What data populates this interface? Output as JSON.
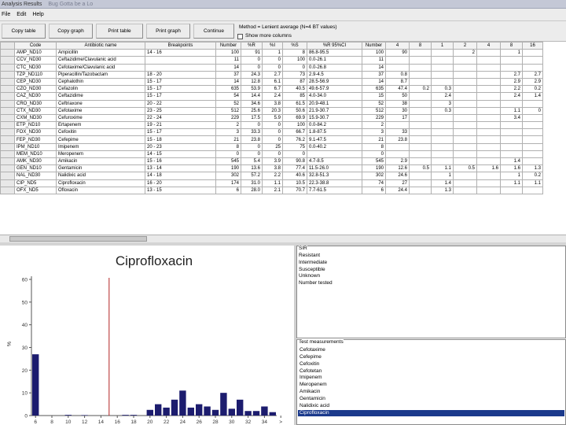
{
  "window": {
    "title": "Analysis Results",
    "subtitle": "Bug Gotta be a Lo"
  },
  "menu": {
    "items": [
      "File",
      "Edit",
      "Help"
    ]
  },
  "toolbar": {
    "copy_table": "Copy table",
    "copy_graph": "Copy graph",
    "print_table": "Print table",
    "print_graph": "Print graph",
    "continue": "Continue",
    "note": "Method = Lenient average (N=4 BT values)",
    "show_more": "Show more columns"
  },
  "table": {
    "columns": [
      "Code",
      "Antibiotic name",
      "Breakpoints",
      "Number",
      "%R",
      "%I",
      "%S",
      "%R 95%CI",
      "Number",
      "4",
      "8",
      "1",
      "2",
      "4",
      "8",
      "16"
    ],
    "rows": [
      [
        "AMP_ND10",
        "Ampicillin",
        "14 - 16",
        "100",
        "91",
        "1",
        "8",
        "86.8-95.5",
        "100",
        "90",
        "",
        "",
        "2",
        "",
        "1",
        ""
      ],
      [
        "CCV_ND30",
        "Ceftazidime/Clavulanic acid",
        "",
        "11",
        "0",
        "0",
        "100",
        "0.0-26.1",
        "11",
        "",
        "",
        "",
        "",
        "",
        "",
        ""
      ],
      [
        "CTC_ND30",
        "Cefotaxime/Clavulanic acid",
        "",
        "14",
        "0",
        "0",
        "0",
        "0.0-26.8",
        "14",
        "",
        "",
        "",
        "",
        "",
        "",
        ""
      ],
      [
        "TZP_ND110",
        "Piperacillin/Tazobactam",
        "18 - 20",
        "37",
        "24.3",
        "2.7",
        "73",
        "2.9-4.5",
        "37",
        "0.8",
        "",
        "",
        "",
        "",
        "2.7",
        "2.7"
      ],
      [
        "CEP_ND30",
        "Cephalothin",
        "15 - 17",
        "14",
        "12.8",
        "6.1",
        "87",
        "28.5-56.9",
        "14",
        "8.7",
        "",
        "",
        "",
        "",
        "2.9",
        "2.9"
      ],
      [
        "CZO_ND30",
        "Cefazolin",
        "15 - 17",
        "635",
        "53.9",
        "6.7",
        "40.5",
        "49.6-57.9",
        "635",
        "47.4",
        "0.2",
        "0.3",
        "",
        "",
        "2.2",
        "0.2"
      ],
      [
        "CAZ_ND30",
        "Ceftazidime",
        "15 - 17",
        "54",
        "14.4",
        "2.4",
        "85",
        "4.0-34.0",
        "15",
        "50",
        "",
        "2.4",
        "",
        "",
        "2.4",
        "1.4"
      ],
      [
        "CRO_ND30",
        "Ceftriaxone",
        "20 - 22",
        "52",
        "34.6",
        "3.8",
        "61.5",
        "20.9-48.1",
        "52",
        "38",
        "",
        "3",
        "",
        "",
        "",
        ""
      ],
      [
        "CTX_ND30",
        "Cefotaxime",
        "23 - 25",
        "512",
        "25.6",
        "20.3",
        "50.6",
        "21.9-30.7",
        "512",
        "30",
        "",
        "0.3",
        "",
        "",
        "1.1",
        "0"
      ],
      [
        "CXM_ND30",
        "Cefuroxime",
        "22 - 24",
        "229",
        "17.5",
        "5.9",
        "69.9",
        "15.9-30.7",
        "229",
        "17",
        "",
        "",
        "",
        "",
        "3.4",
        ""
      ],
      [
        "ETP_ND10",
        "Ertapenem",
        "19 - 21",
        "2",
        "0",
        "0",
        "100",
        "0.0-84.2",
        "2",
        "",
        "",
        "",
        "",
        "",
        "",
        ""
      ],
      [
        "FOX_ND30",
        "Cefoxitin",
        "15 - 17",
        "3",
        "33.3",
        "0",
        "66.7",
        "1.8-87.5",
        "3",
        "33",
        "",
        "",
        "",
        "",
        "",
        ""
      ],
      [
        "FEP_ND30",
        "Cefepime",
        "15 - 18",
        "21",
        "23.8",
        "0",
        "76.2",
        "9.1-47.5",
        "21",
        "23.8",
        "",
        "",
        "",
        "",
        "",
        ""
      ],
      [
        "IPM_ND10",
        "Imipenem",
        "20 - 23",
        "8",
        "0",
        "25",
        "75",
        "0.0-40.2",
        "8",
        "",
        "",
        "",
        "",
        "",
        "",
        ""
      ],
      [
        "MEM_ND10",
        "Meropenem",
        "14 - 15",
        "0",
        "0",
        "0",
        "0",
        "",
        "0",
        "",
        "",
        "",
        "",
        "",
        "",
        ""
      ],
      [
        "AMK_ND30",
        "Amikacin",
        "15 - 16",
        "545",
        "5.4",
        "3.9",
        "90.8",
        "4.7-8.5",
        "545",
        "2.9",
        "",
        "",
        "",
        "",
        "1.4",
        ""
      ],
      [
        "GEN_ND10",
        "Gentamicin",
        "13 - 14",
        "190",
        "13.6",
        "3.8",
        "77.4",
        "11.5-26.0",
        "190",
        "12.6",
        "0.5",
        "1.1",
        "0.5",
        "1.6",
        "1.6",
        "1.3"
      ],
      [
        "NAL_ND30",
        "Nalidixic acid",
        "14 - 18",
        "302",
        "57.2",
        "2.2",
        "40.6",
        "32.8-51.3",
        "302",
        "24.6",
        "",
        "1",
        "",
        "",
        "1",
        "0.2"
      ],
      [
        "CIP_ND5",
        "Ciprofloxacin",
        "16 - 20",
        "174",
        "31.0",
        "1.1",
        "10.5",
        "22.3-38.8",
        "74",
        "27",
        "",
        "1.4",
        "",
        "",
        "1.1",
        "1.1"
      ],
      [
        "OFX_ND5",
        "Ofloxacin",
        "13 - 15",
        "6",
        "28.0",
        "2.1",
        "70.7",
        "7.7-61.5",
        "6",
        "24.4",
        "",
        "1.3",
        "",
        "",
        "",
        ""
      ]
    ]
  },
  "chart_data": {
    "type": "bar",
    "title": "Ciprofloxacin",
    "xlabel": "",
    "ylabel": "%",
    "ylim": [
      0,
      60
    ],
    "yticks": [
      0,
      10,
      20,
      30,
      40,
      50,
      60
    ],
    "x": [
      6,
      7,
      8,
      9,
      10,
      11,
      12,
      13,
      14,
      15,
      16,
      17,
      18,
      19,
      20,
      21,
      22,
      23,
      24,
      25,
      26,
      27,
      28,
      29,
      30,
      31,
      32,
      33,
      34,
      35
    ],
    "values": [
      27,
      0,
      0,
      0,
      0.3,
      0,
      0.2,
      0,
      0,
      0,
      0,
      0.3,
      0.3,
      0,
      2.5,
      5,
      3.5,
      7,
      11,
      3.5,
      5,
      4,
      2.5,
      10,
      3,
      7,
      2,
      2,
      4,
      1.5
    ],
    "xtick_labels": [
      "6",
      "8",
      "10",
      "12",
      "14",
      "16",
      "18",
      "20",
      "22",
      "24",
      "26",
      "28",
      "30",
      "32",
      "34",
      ">"
    ],
    "breakpoint_line": 15,
    "bar_color": "#1c1c6e",
    "line_color": "#b22222"
  },
  "sir": {
    "label": "SIR",
    "items": [
      "Resistant",
      "Intermediate",
      "Susceptible",
      "Unknown",
      "Number tested"
    ]
  },
  "tests": {
    "label": "Test measurements",
    "items": [
      "Cefotaxime",
      "Cefepime",
      "Cefoxitin",
      "Cefotetan",
      "Imipenem",
      "Meropenem",
      "Amikacin",
      "Gentamicin",
      "Nalidixic acid",
      "Ciprofloxacin"
    ],
    "selected_index": 9,
    "selected_color": "#1b3a8c"
  }
}
